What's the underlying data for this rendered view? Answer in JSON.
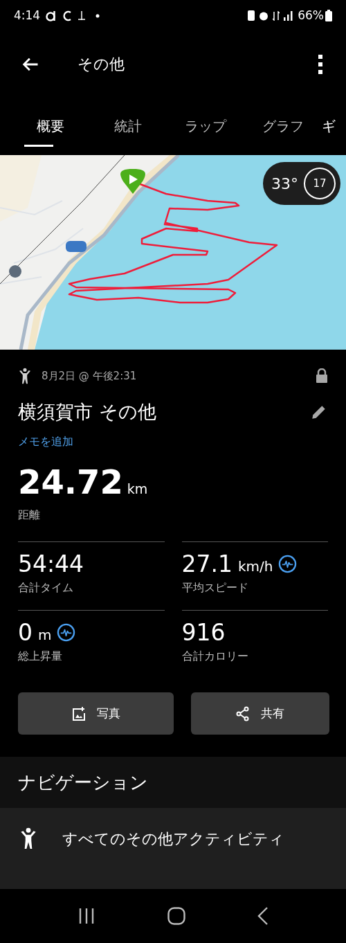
{
  "status_bar": {
    "time": "4:14",
    "battery": "66%"
  },
  "app_bar": {
    "title": "その他"
  },
  "tabs": [
    {
      "label": "概要",
      "selected": true
    },
    {
      "label": "統計",
      "selected": false
    },
    {
      "label": "ラップ",
      "selected": false
    },
    {
      "label": "グラフ",
      "selected": false
    },
    {
      "label": "ギ",
      "selected": false
    }
  ],
  "map": {
    "weather": {
      "temperature": "33°",
      "wind": "17"
    }
  },
  "activity": {
    "date": "8月2日 @ 午後2:31",
    "locked": true,
    "title": "横須賀市 その他",
    "add_note": "メモを追加"
  },
  "distance": {
    "value": "24.72",
    "unit": "km",
    "label": "距離"
  },
  "stats": [
    {
      "value": "54:44",
      "label": "合計タイム",
      "graph": false
    },
    {
      "value": "27.1",
      "unit": "km/h",
      "label": "平均スピード",
      "graph": true
    },
    {
      "value": "0",
      "unit": "m",
      "label": "総上昇量",
      "graph": true
    },
    {
      "value": "916",
      "label": "合計カロリー",
      "graph": false
    }
  ],
  "buttons": [
    {
      "label": "写真"
    },
    {
      "kind": "share",
      "label": "共有"
    }
  ],
  "navigation": {
    "title": "ナビゲーション",
    "items": [
      {
        "label": "すべてのその他アクティビティ"
      }
    ]
  }
}
